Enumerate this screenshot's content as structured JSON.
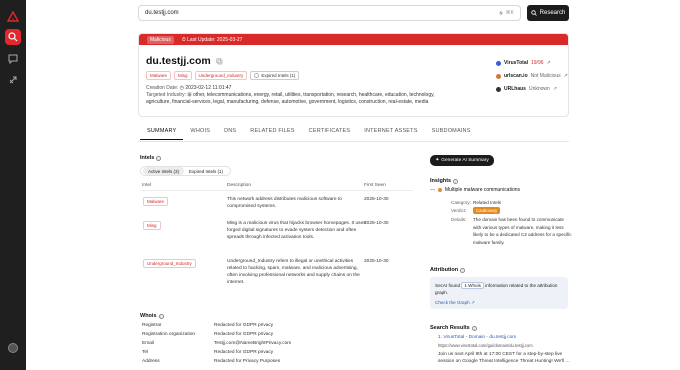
{
  "colors": {
    "accent": "#e0282e",
    "banner": "#d92a2a",
    "dark": "#1c1c1c",
    "link": "#2a5db0",
    "verdict": "#e38a1a"
  },
  "search": {
    "value": "du.testjj.com",
    "shortcut": "⌘K",
    "button": "Research"
  },
  "banner": {
    "status": "Malicious",
    "last_update_label": "Last Update: 2025-03-27"
  },
  "domain": {
    "title": "du.testjj.com",
    "tags": [
      "Malware",
      "Misg",
      "Underground_Industry"
    ],
    "expired_label": "Expired Intels (1)"
  },
  "meta": {
    "creation_label": "Creation Date:",
    "creation_value": "2023-02-12 11:01:47",
    "industry_label": "Targeted Industry:",
    "industry_value": "other, telecommunications, energy, retail, utilities, transportation, research, healthcare, education, technology, agriculture, financial-services, legal, manufacturing, defense, automotive, government, logistics, construction, real-estate, media"
  },
  "vendors": [
    {
      "name": "VirusTotal",
      "value": "19/96",
      "style": "v"
    },
    {
      "name": "urlscan.io",
      "value": "Not Malicious",
      "style": "u"
    },
    {
      "name": "URLhaus",
      "value": "Unknown",
      "style": "u"
    }
  ],
  "tabs": [
    "SUMMARY",
    "WHOIS",
    "DNS",
    "RELATED FILES",
    "CERTIFICATES",
    "INTERNET ASSETS",
    "SUBDOMAINS"
  ],
  "intels": {
    "title": "Intels",
    "subtabs": [
      "Active Intels (3)",
      "Expired Intels (1)"
    ],
    "headers": {
      "intel": "Intel",
      "description": "Description",
      "first_seen": "First Seen"
    },
    "rows": [
      {
        "name": "Malware",
        "desc": "This network address distributes malicious software to compromised systems.",
        "date": "2025-10-30"
      },
      {
        "name": "Misg",
        "desc": "Misg is a malicious virus that hijacks browser homepages. It uses forged digital signatures to evade system detection and often spreads through infected activation tools.",
        "date": "2025-10-30"
      },
      {
        "name": "Underground_Industry",
        "desc": "Underground_Industry refers to illegal or unethical activities related to hacking, spam, malware, and malicious advertising, often involving professional networks and supply chains on the internet.",
        "date": "2025-10-30"
      }
    ]
  },
  "whois": {
    "title": "Whois",
    "rows": [
      {
        "label": "Registrar",
        "value": "Redacted for GDPR privacy"
      },
      {
        "label": "Registration organization",
        "value": "Redacted for GDPR privacy"
      },
      {
        "label": "Email",
        "value": "Testjj.com@NameBrightPrivacy.com"
      },
      {
        "label": "Tel",
        "value": "Redacted for GDPR privacy"
      },
      {
        "label": "Address",
        "value": "Redacted for Privacy Purposes"
      }
    ]
  },
  "generate_button": "Generate AI Summary",
  "insights": {
    "title": "Insights",
    "item": "Multiple malware communications",
    "category_label": "Category:",
    "category_value": "Related Intels",
    "verdict_label": "Verdict:",
    "verdict_value": "Cautionary",
    "details_label": "Details:",
    "details_value": "The domain has been found to communicate with various types of malware, making it less likely to be a dedicated C2 address for a specific malware family."
  },
  "attribution": {
    "title": "Attribution",
    "text_prefix": "SecAI found",
    "text_badge": "1 Whois",
    "text_suffix": "information related to the attribution graph.",
    "link": "Check the Graph"
  },
  "search_results": {
    "title": "Search Results",
    "items": [
      {
        "title": "1. VirusTotal - Domain - du.testjj.com",
        "url": "https://www.virustotal.com/gui/domain/du.testjj.com",
        "snippet": "Join us next April 9th at 17:00 CEST for a step-by-step live session on Google Threat Intelligence Threat Hunting! We'll ..."
      }
    ]
  }
}
